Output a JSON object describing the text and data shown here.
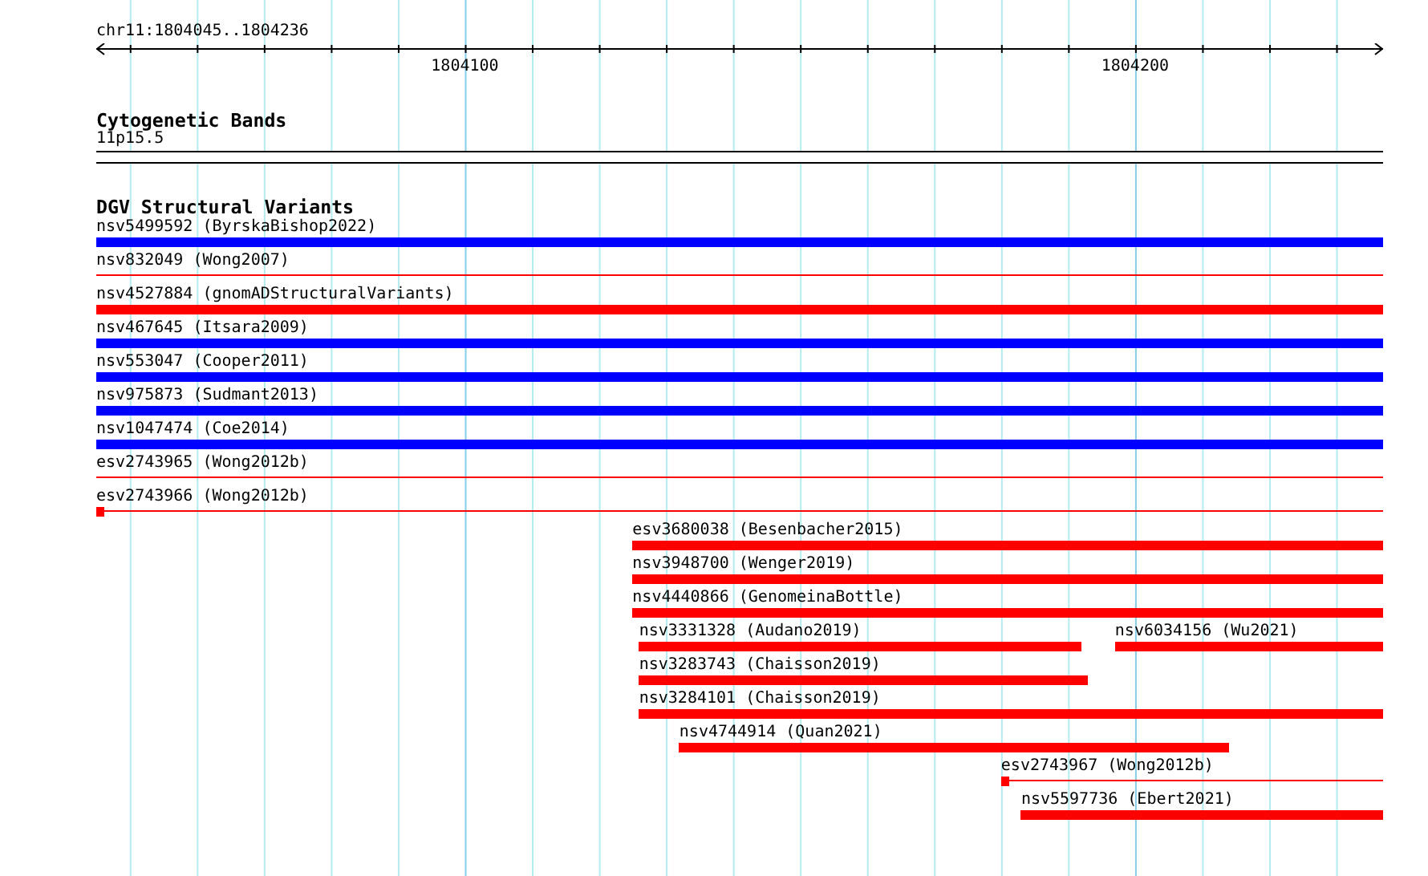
{
  "ruler": {
    "location": "chr11:1804045..1804236",
    "labels": [
      "1804100",
      "1804200"
    ]
  },
  "cytoband_track": {
    "title": "Cytogenetic Bands",
    "band": "11p15.5"
  },
  "variant_track": {
    "title": "DGV Structural Variants",
    "rows": [
      {
        "features": [
          {
            "kind": "bar",
            "label": "nsv5499592 (ByrskaBishop2022)",
            "color": "#0000ff"
          }
        ]
      },
      {
        "features": [
          {
            "kind": "line",
            "label": "nsv832049 (Wong2007)",
            "color": "#ff0000",
            "marker": false
          }
        ]
      },
      {
        "features": [
          {
            "kind": "bar",
            "label": "nsv4527884 (gnomADStructuralVariants)",
            "color": "#ff0000"
          }
        ]
      },
      {
        "features": [
          {
            "kind": "bar",
            "label": "nsv467645 (Itsara2009)",
            "color": "#0000ff"
          }
        ]
      },
      {
        "features": [
          {
            "kind": "bar",
            "label": "nsv553047 (Cooper2011)",
            "color": "#0000ff"
          }
        ]
      },
      {
        "features": [
          {
            "kind": "bar",
            "label": "nsv975873 (Sudmant2013)",
            "color": "#0000ff"
          }
        ]
      },
      {
        "features": [
          {
            "kind": "bar",
            "label": "nsv1047474 (Coe2014)",
            "color": "#0000ff"
          }
        ]
      },
      {
        "features": [
          {
            "kind": "line",
            "label": "esv2743965 (Wong2012b)",
            "color": "#ff0000",
            "marker": false
          }
        ]
      },
      {
        "features": [
          {
            "kind": "line",
            "label": "esv2743966 (Wong2012b)",
            "color": "#ff0000",
            "marker": true
          }
        ]
      },
      {
        "features": [
          {
            "kind": "bar",
            "label": "esv3680038 (Besenbacher2015)",
            "color": "#ff0000"
          }
        ]
      },
      {
        "features": [
          {
            "kind": "bar",
            "label": "nsv3948700 (Wenger2019)",
            "color": "#ff0000"
          }
        ]
      },
      {
        "features": [
          {
            "kind": "bar",
            "label": "nsv4440866 (GenomeinaBottle)",
            "color": "#ff0000"
          }
        ]
      },
      {
        "features": [
          {
            "kind": "bar",
            "label": "nsv3331328 (Audano2019)",
            "color": "#ff0000"
          },
          {
            "kind": "bar",
            "label": "nsv6034156 (Wu2021)",
            "color": "#ff0000"
          }
        ]
      },
      {
        "features": [
          {
            "kind": "bar",
            "label": "nsv3283743 (Chaisson2019)",
            "color": "#ff0000"
          }
        ]
      },
      {
        "features": [
          {
            "kind": "bar",
            "label": "nsv3284101 (Chaisson2019)",
            "color": "#ff0000"
          }
        ]
      },
      {
        "features": [
          {
            "kind": "bar",
            "label": "nsv4744914 (Quan2021)",
            "color": "#ff0000"
          }
        ]
      },
      {
        "features": [
          {
            "kind": "line",
            "label": "esv2743967 (Wong2012b)",
            "color": "#ff0000",
            "marker": true
          }
        ]
      },
      {
        "features": [
          {
            "kind": "bar",
            "label": "nsv5597736 (Ebert2021)",
            "color": "#ff0000"
          }
        ]
      }
    ]
  }
}
